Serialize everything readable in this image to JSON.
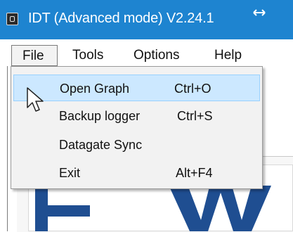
{
  "window": {
    "title": "IDT (Advanced mode) V2.24.1",
    "titlebar_color": "#1e84d0",
    "app_icon": "app-icon",
    "resize_icon": "resize-arrows-icon"
  },
  "menubar": {
    "items": [
      {
        "label": "File",
        "active": true
      },
      {
        "label": "Tools"
      },
      {
        "label": "Options"
      },
      {
        "label": "Help"
      }
    ]
  },
  "file_menu": {
    "items": [
      {
        "label": "Open Graph",
        "shortcut": "Ctrl+O",
        "highlighted": true
      },
      {
        "label": "Backup logger",
        "shortcut": "Ctrl+S"
      },
      {
        "label": "Datagate Sync",
        "shortcut": ""
      },
      {
        "label": "Exit",
        "shortcut": "Alt+F4"
      }
    ],
    "highlight_color": "#cce8ff"
  },
  "cursor": {
    "icon": "mouse-pointer-icon"
  },
  "logo": {
    "icon": "brand-logo-icon",
    "color": "#1f4e91"
  }
}
